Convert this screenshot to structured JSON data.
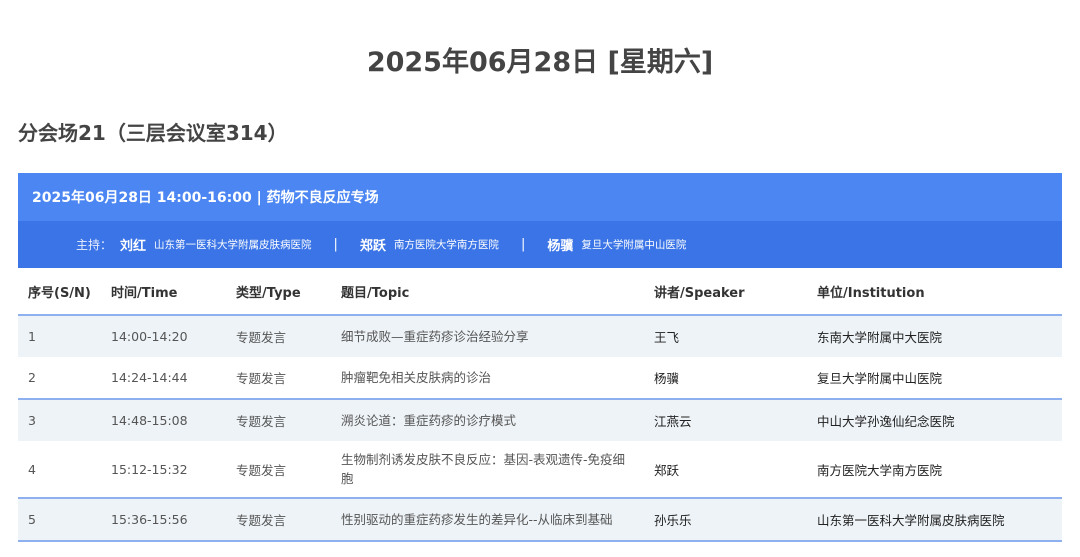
{
  "date_title": "2025年06月28日 [星期六]",
  "venue_title": "分会场21（三层会议室314）",
  "session": {
    "title": "2025年06月28日 14:00-16:00 | 药物不良反应专场",
    "chair_label": "主持：",
    "chairs": [
      {
        "name": "刘红",
        "institution": "山东第一医科大学附属皮肤病医院"
      },
      {
        "name": "郑跃",
        "institution": "南方医院大学南方医院"
      },
      {
        "name": "杨骥",
        "institution": "复旦大学附属中山医院"
      }
    ],
    "separator": "|"
  },
  "table": {
    "headers": [
      "序号(S/N)",
      "时间/Time",
      "类型/Type",
      "题目/Topic",
      "讲者/Speaker",
      "单位/Institution"
    ],
    "rows": [
      {
        "sn": "1",
        "time": "14:00-14:20",
        "type": "专题发言",
        "topic": "细节成败—重症药疹诊治经验分享",
        "speaker": "王飞",
        "institution": "东南大学附属中大医院"
      },
      {
        "sn": "2",
        "time": "14:24-14:44",
        "type": "专题发言",
        "topic": "肿瘤靶免相关皮肤病的诊治",
        "speaker": "杨骥",
        "institution": "复旦大学附属中山医院"
      },
      {
        "sn": "3",
        "time": "14:48-15:08",
        "type": "专题发言",
        "topic": "溯炎论道：重症药疹的诊疗模式",
        "speaker": "江燕云",
        "institution": "中山大学孙逸仙纪念医院"
      },
      {
        "sn": "4",
        "time": "15:12-15:32",
        "type": "专题发言",
        "topic": "生物制剂诱发皮肤不良反应：基因-表观遗传-免疫细胞",
        "speaker": "郑跃",
        "institution": "南方医院大学南方医院"
      },
      {
        "sn": "5",
        "time": "15:36-15:56",
        "type": "专题发言",
        "topic": "性别驱动的重症药疹发生的差异化--从临床到基础",
        "speaker": "孙乐乐",
        "institution": "山东第一医科大学附属皮肤病医院"
      }
    ]
  }
}
